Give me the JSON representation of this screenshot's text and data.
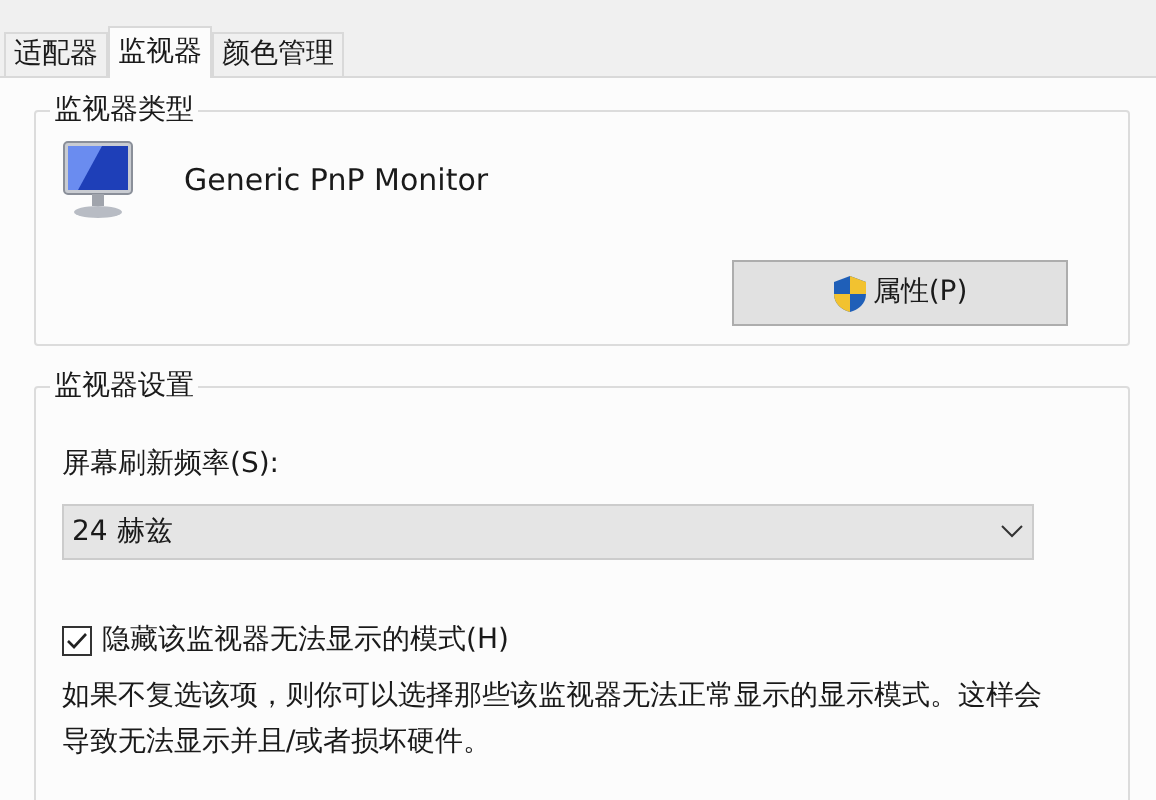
{
  "tabs": [
    {
      "label": "适配器",
      "selected": false
    },
    {
      "label": "监视器",
      "selected": true
    },
    {
      "label": "颜色管理",
      "selected": false
    }
  ],
  "monitor_type": {
    "title": "监视器类型",
    "name": "Generic PnP Monitor",
    "button": "属性(P)"
  },
  "monitor_settings": {
    "title": "监视器设置",
    "refresh_label": "屏幕刷新频率(S):",
    "refresh_value": "24 赫兹",
    "hide_modes": {
      "label": "隐藏该监视器无法显示的模式(H)",
      "checked": true
    },
    "description": "如果不复选该项，则你可以选择那些该监视器无法正常显示的显示模式。这样会导致无法显示并且/或者损坏硬件。"
  }
}
